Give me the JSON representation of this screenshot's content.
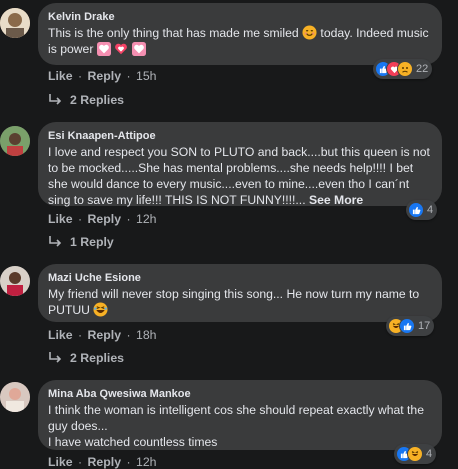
{
  "comments": [
    {
      "author": "Kelvin Drake",
      "text": "This is the only thing that has made me smiled",
      "text_after": " today. Indeed music is power ",
      "actions": {
        "like": "Like",
        "reply": "Reply",
        "time": "15h"
      },
      "reaction_count": "22",
      "reaction_types": [
        "like-icon",
        "love-icon",
        "sad-icon"
      ],
      "replies": "2 Replies"
    },
    {
      "author": "Esi Knaapen-Attipoe",
      "text": "I love and respect you SON to PLUTO and back....but this queen is not to be mocked.....She has mental problems....she needs help!!!! I bet she would dance to every music....even to mine....even tho I can´nt sing to save my life!!! THIS IS NOT FUNNY!!!!...",
      "see_more": "See More",
      "actions": {
        "like": "Like",
        "reply": "Reply",
        "time": "12h"
      },
      "reaction_count": "4",
      "reaction_types": [
        "like-icon"
      ],
      "replies": "1 Reply"
    },
    {
      "author": "Mazi Uche Esione",
      "text": "My friend will never stop singing this song... He now turn my name to PUTUU",
      "actions": {
        "like": "Like",
        "reply": "Reply",
        "time": "18h"
      },
      "reaction_count": "17",
      "reaction_types": [
        "haha-icon",
        "like-icon"
      ],
      "replies": "2 Replies"
    },
    {
      "author": "Mina Aba Qwesiwa Mankoe",
      "text": "I think the woman is intelligent cos she should repeat exactly what the guy does...",
      "text2": "I have watched countless times",
      "actions": {
        "like": "Like",
        "reply": "Reply",
        "time": "12h"
      },
      "reaction_count": "4",
      "reaction_types": [
        "like-icon",
        "haha-icon"
      ]
    }
  ],
  "colors": {
    "background": "#18191a",
    "bubble": "#3a3b3c",
    "like": "#1877f2",
    "love": "#f33e58",
    "haha": "#f7b125"
  }
}
